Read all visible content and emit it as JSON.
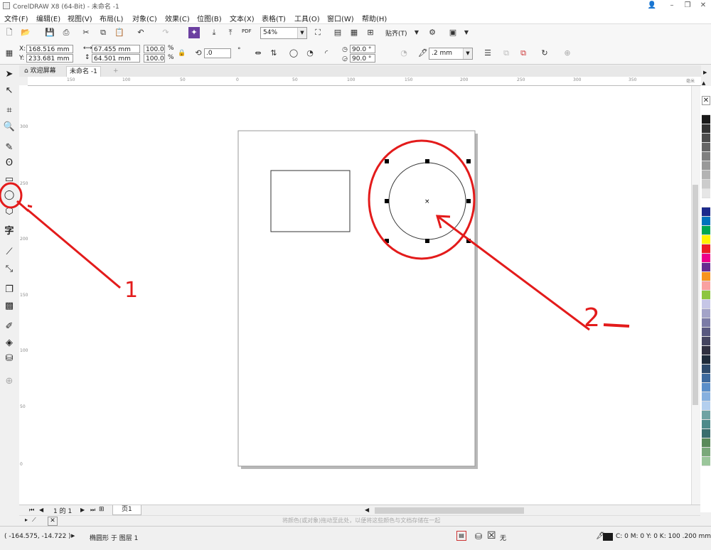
{
  "titlebar": {
    "title": "CorelDRAW X8 (64-Bit) - 未命名 -1"
  },
  "menu": [
    "文件(F)",
    "编辑(E)",
    "视图(V)",
    "布局(L)",
    "对象(C)",
    "效果(C)",
    "位图(B)",
    "文本(X)",
    "表格(T)",
    "工具(O)",
    "窗口(W)",
    "帮助(H)"
  ],
  "standard_toolbar": {
    "pdf_label": "PDF",
    "zoom": "54%",
    "snap_label": "贴齐(T)"
  },
  "property_bar": {
    "x": "168.516 mm",
    "y": "233.681 mm",
    "x_label": "X:",
    "y_label": "Y:",
    "width": "67.455 mm",
    "height": "64.501 mm",
    "scale_w": "100.0",
    "scale_h": "100.0",
    "pct": "%",
    "rotation": ".0",
    "start_angle": "90.0 °",
    "end_angle": "90.0 °",
    "outline_width": ".2 mm"
  },
  "tabs": [
    "欢迎屏幕",
    "未命名 -1"
  ],
  "hruler_ticks": [
    "150",
    "100",
    "50",
    "0",
    "50",
    "100",
    "150",
    "200",
    "250",
    "300",
    "350"
  ],
  "hruler_unit": "毫米",
  "vruler_ticks": [
    "300",
    "250",
    "200",
    "150",
    "100",
    "50",
    "0"
  ],
  "annotations": {
    "label1": "1",
    "label2": "2"
  },
  "page_nav": {
    "count": "1 的 1",
    "page_tab": "页1"
  },
  "color_hint": "将颜色(或对象)拖动至此处，以便将这些颜色与文档存储在一起",
  "status": {
    "coords": "( -164.575, -14.722 )",
    "object_info": "椭圆形 于 图层 1",
    "fill_label": "无",
    "outline_info": "C: 0 M: 0 Y: 0 K: 100  .200 mm"
  },
  "palette": [
    "#ffffff",
    "#1a1a1a",
    "#333333",
    "#4d4d4d",
    "#666666",
    "#808080",
    "#999999",
    "#b3b3b3",
    "#cccccc",
    "#e6e6e6",
    "#ffffff",
    "#1c2a8c",
    "#0072bc",
    "#00a651",
    "#fff200",
    "#ed1c24",
    "#ec008c",
    "#662d91",
    "#f7941d",
    "#f9a1a1",
    "#8dc63f",
    "#c6c6e6",
    "#a3a3c8",
    "#7b7ba6",
    "#595980",
    "#454560",
    "#303040",
    "#1f2b3a",
    "#2e4a6b",
    "#3d6a9e",
    "#5b8fc9",
    "#86b0df",
    "#b4cfee",
    "#6fa3a3",
    "#4e8a8a",
    "#3a6e6e",
    "#5a8a5a",
    "#7aa87a",
    "#9bc69b"
  ],
  "colors": {
    "annotation_red": "#e31b1b",
    "selection_black": "#000000"
  }
}
